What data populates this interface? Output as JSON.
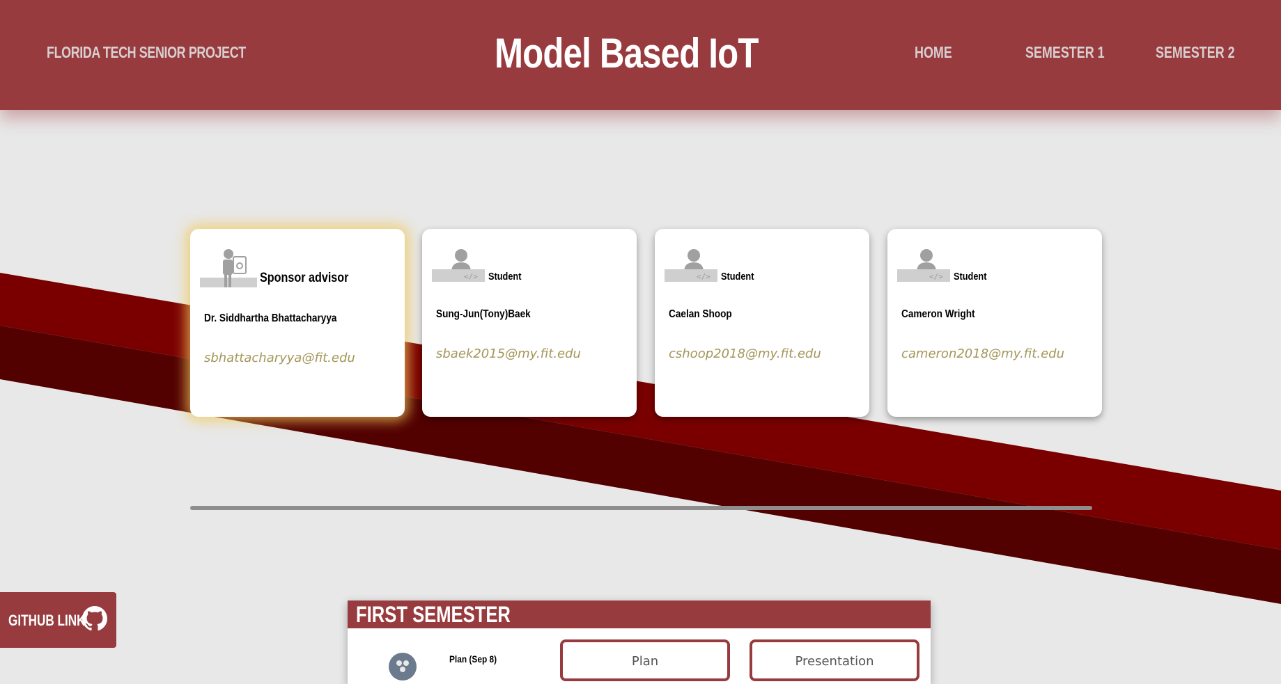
{
  "colors": {
    "header_bg": "#983b3e",
    "stripe_light": "#7a0000",
    "stripe_dark": "#520000",
    "email": "#a39658",
    "page_bg": "#e8e8e8"
  },
  "header": {
    "brand": "FLORIDA TECH SENIOR PROJECT",
    "title": "Model Based IoT",
    "nav": [
      "HOME",
      "SEMESTER 1",
      "SEMESTER 2"
    ]
  },
  "team": [
    {
      "role": "Sponsor advisor",
      "icon": "advisor-icon",
      "name": "Dr. Siddhartha Bhattacharyya",
      "email": "sbhattacharyya@fit.edu"
    },
    {
      "role": "Student",
      "icon": "student-coder-icon",
      "name": "Sung-Jun(Tony)Baek",
      "email": "sbaek2015@my.fit.edu"
    },
    {
      "role": "Student",
      "icon": "student-coder-icon",
      "name": "Caelan Shoop",
      "email": "cshoop2018@my.fit.edu"
    },
    {
      "role": "Student",
      "icon": "student-coder-icon",
      "name": "Cameron Wright",
      "email": "cameron2018@my.fit.edu"
    }
  ],
  "github": {
    "label": "GITHUB LINK",
    "icon": "github-icon"
  },
  "first_semester": {
    "title": "FIRST SEMESTER",
    "milestone": "Plan (Sep 8)",
    "buttons": [
      "Plan",
      "Presentation"
    ]
  }
}
